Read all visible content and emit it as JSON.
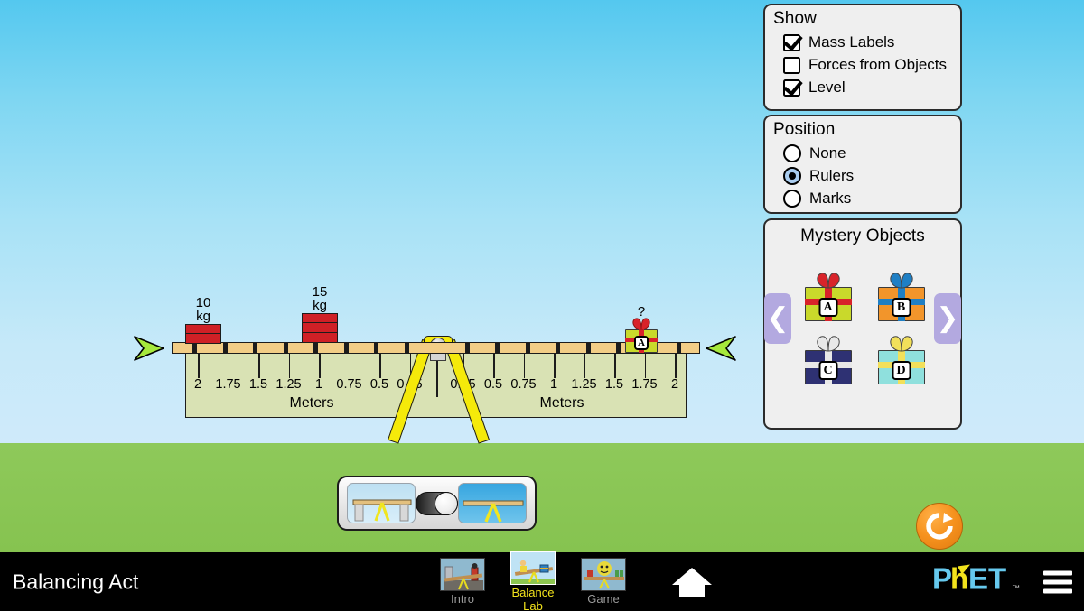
{
  "sim": {
    "title": "Balancing Act",
    "sky_color": "#7ed6f2",
    "ground_color": "#8cc550"
  },
  "show_panel": {
    "title": "Show",
    "options": [
      {
        "label": "Mass Labels",
        "checked": true
      },
      {
        "label": "Forces from Objects",
        "checked": false
      },
      {
        "label": "Level",
        "checked": true
      }
    ]
  },
  "position_panel": {
    "title": "Position",
    "options": [
      {
        "label": "None",
        "selected": false
      },
      {
        "label": "Rulers",
        "selected": true
      },
      {
        "label": "Marks",
        "selected": false
      }
    ]
  },
  "mystery_panel": {
    "title": "Mystery Objects",
    "prev_icon": "chevron-left-icon",
    "next_icon": "chevron-right-icon",
    "items": [
      {
        "label": "A",
        "box_color": "#c9d92b",
        "ribbon_color": "#d8232a"
      },
      {
        "label": "B",
        "box_color": "#f2952b",
        "ribbon_color": "#1f7fc4"
      },
      {
        "label": "C",
        "box_color": "#2e3173",
        "ribbon_color": "#e8e8e8"
      },
      {
        "label": "D",
        "box_color": "#8fe0dd",
        "ribbon_color": "#f2e05a"
      }
    ]
  },
  "beam": {
    "left_ruler_unit": "Meters",
    "right_ruler_unit": "Meters",
    "left_ticks": [
      "2",
      "1.75",
      "1.5",
      "1.25",
      "1",
      "0.75",
      "0.5",
      "0.25"
    ],
    "right_ticks": [
      "0.25",
      "0.5",
      "0.75",
      "1",
      "1.25",
      "1.5",
      "1.75",
      "2"
    ],
    "level_indicator_color": "#a6e83c",
    "fulcrum_color": "#f5ea0a",
    "beam_color": "#f2cd86",
    "masses": [
      {
        "label_line1": "10",
        "label_line2": "kg",
        "position_m": 2,
        "side": "left",
        "bricks": 2,
        "color": "#cf2026",
        "type": "brick-stack"
      },
      {
        "label_line1": "15",
        "label_line2": "kg",
        "position_m": 1,
        "side": "left",
        "bricks": 3,
        "color": "#cf2026",
        "type": "brick-stack"
      },
      {
        "label_line1": "?",
        "label_line2": "",
        "position_m": 1.75,
        "side": "right",
        "tag": "A",
        "type": "mystery-gift"
      }
    ]
  },
  "supports_toggle": {
    "left_icon": "supports-on-icon",
    "right_icon": "supports-off-icon",
    "state": "off"
  },
  "reset": {
    "icon": "reset-all-icon",
    "color": "#f6921e"
  },
  "navbar": {
    "tabs": [
      {
        "label": "Intro",
        "active": false
      },
      {
        "label": "Balance Lab",
        "active": true
      },
      {
        "label": "Game",
        "active": false
      }
    ],
    "home_icon": "home-icon",
    "menu_icon": "hamburger-menu-icon",
    "logo_text_1": "P",
    "logo_text_2": "h",
    "logo_text_3": "ET",
    "logo_tm": "™"
  }
}
